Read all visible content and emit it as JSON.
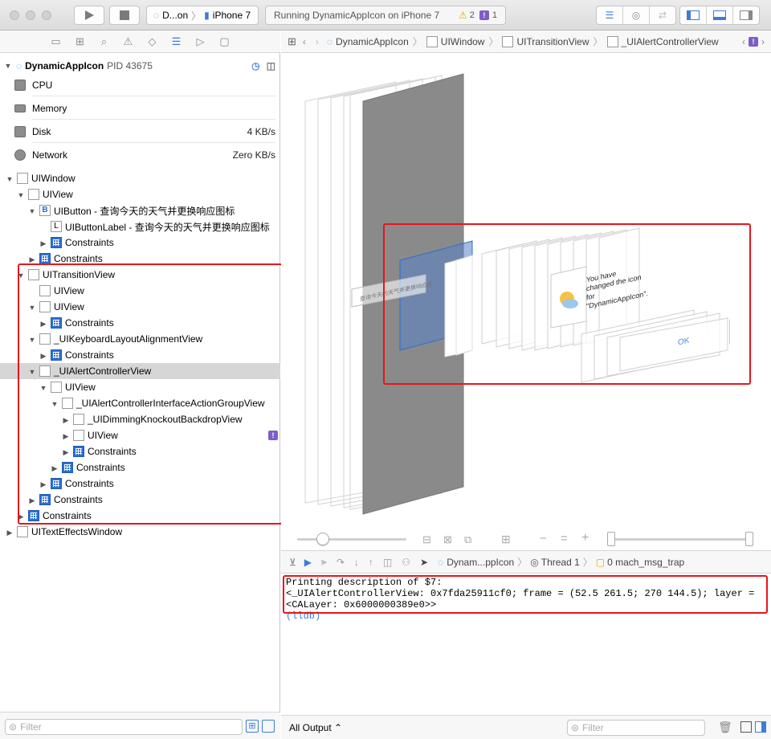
{
  "toolbar": {
    "scheme": "D...on",
    "device": "iPhone 7",
    "status": "Running DynamicAppIcon on iPhone 7",
    "warnings": "2",
    "issues": "1"
  },
  "process": {
    "name": "DynamicAppIcon",
    "pid": "PID 43675"
  },
  "gauges": [
    {
      "label": "CPU",
      "value": "",
      "icon": "cpu-icon"
    },
    {
      "label": "Memory",
      "value": "",
      "icon": "memory-icon"
    },
    {
      "label": "Disk",
      "value": "4 KB/s",
      "icon": "disk-icon"
    },
    {
      "label": "Network",
      "value": "Zero KB/s",
      "icon": "network-icon"
    }
  ],
  "tree": [
    {
      "label": "UIWindow",
      "depth": 0,
      "tri": "open",
      "icon": "view"
    },
    {
      "label": "UIView",
      "depth": 1,
      "tri": "open",
      "icon": "view"
    },
    {
      "label": "UIButton - 查询今天的天气并更换响应图标",
      "depth": 2,
      "tri": "open",
      "icon": "button"
    },
    {
      "label": "UIButtonLabel - 查询今天的天气并更换响应图标",
      "depth": 3,
      "tri": "none",
      "icon": "label"
    },
    {
      "label": "Constraints",
      "depth": 3,
      "tri": "closed",
      "icon": "constraints"
    },
    {
      "label": "Constraints",
      "depth": 2,
      "tri": "closed",
      "icon": "constraints"
    },
    {
      "label": "UITransitionView",
      "depth": 1,
      "tri": "open",
      "icon": "view"
    },
    {
      "label": "UIView",
      "depth": 2,
      "tri": "none",
      "icon": "view"
    },
    {
      "label": "UIView",
      "depth": 2,
      "tri": "open",
      "icon": "view"
    },
    {
      "label": "Constraints",
      "depth": 3,
      "tri": "closed",
      "icon": "constraints"
    },
    {
      "label": "_UIKeyboardLayoutAlignmentView",
      "depth": 2,
      "tri": "open",
      "icon": "view"
    },
    {
      "label": "Constraints",
      "depth": 3,
      "tri": "closed",
      "icon": "constraints"
    },
    {
      "label": "_UIAlertControllerView",
      "depth": 2,
      "tri": "open",
      "icon": "view",
      "selected": true
    },
    {
      "label": "UIView",
      "depth": 3,
      "tri": "open",
      "icon": "view"
    },
    {
      "label": "_UIAlertControllerInterfaceActionGroupView",
      "depth": 4,
      "tri": "open",
      "icon": "view"
    },
    {
      "label": "_UIDimmingKnockoutBackdropView",
      "depth": 5,
      "tri": "closed",
      "icon": "view"
    },
    {
      "label": "UIView",
      "depth": 5,
      "tri": "closed",
      "icon": "view",
      "badge": "!"
    },
    {
      "label": "Constraints",
      "depth": 5,
      "tri": "closed",
      "icon": "constraints"
    },
    {
      "label": "Constraints",
      "depth": 4,
      "tri": "closed",
      "icon": "constraints"
    },
    {
      "label": "Constraints",
      "depth": 3,
      "tri": "closed",
      "icon": "constraints"
    },
    {
      "label": "Constraints",
      "depth": 2,
      "tri": "closed",
      "icon": "constraints"
    },
    {
      "label": "Constraints",
      "depth": 1,
      "tri": "closed",
      "icon": "constraints"
    },
    {
      "label": "UITextEffectsWindow",
      "depth": 0,
      "tri": "closed",
      "icon": "view"
    }
  ],
  "filter_placeholder": "Filter",
  "breadcrumb": [
    "DynamicAppIcon",
    "UIWindow",
    "UITransitionView",
    "_UIAlertControllerView"
  ],
  "alert": {
    "message": "You have changed the icon for \"DynamicAppIcon\".",
    "ok": "OK",
    "button_text": "查询今天的天气并更换响应图标"
  },
  "debugbar": {
    "process": "Dynam...ppIcon",
    "thread": "Thread 1",
    "frame": "0 mach_msg_trap"
  },
  "console": {
    "line1": "Printing description of $7:",
    "line2": "<_UIAlertControllerView: 0x7fda25911cf0; frame = (52.5 261.5; 270 144.5); layer =",
    "line3": "<CALayer: 0x6000000389e0>>",
    "line4": "(lldb)"
  },
  "console_footer": {
    "output_select": "All Output ⌃",
    "filter_placeholder": "Filter"
  }
}
